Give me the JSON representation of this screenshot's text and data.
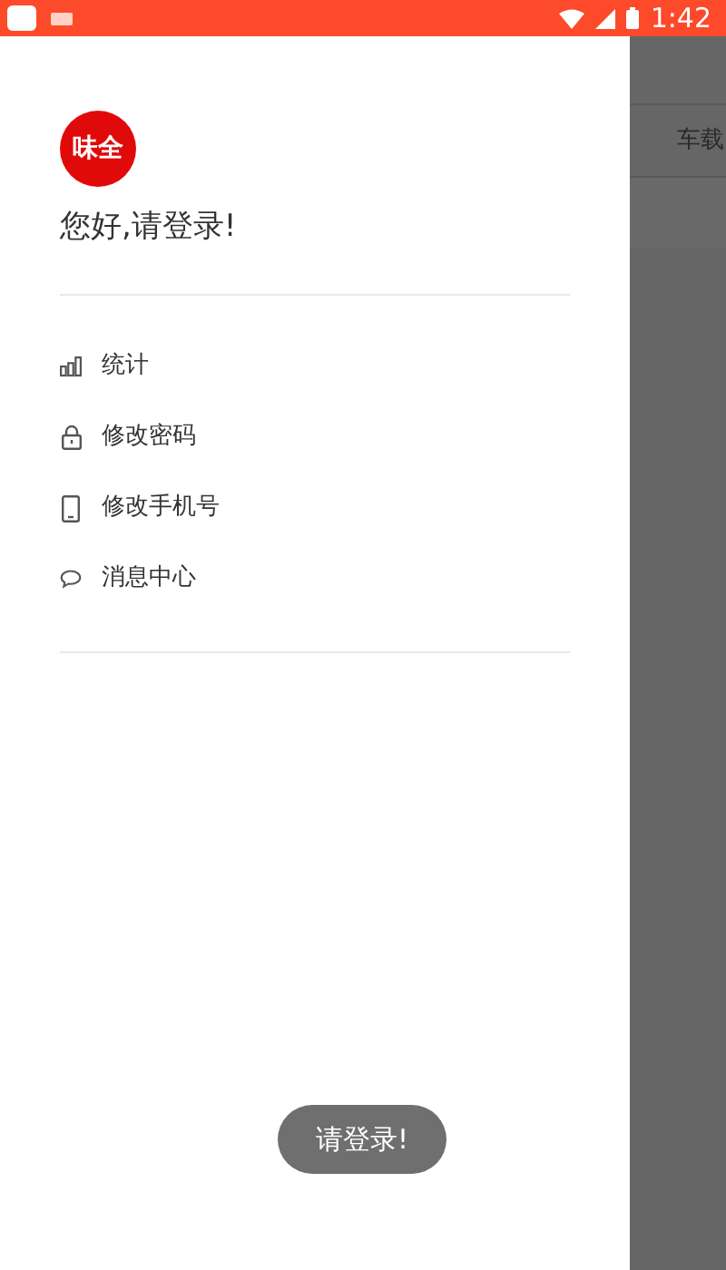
{
  "status_bar": {
    "time": "1:42"
  },
  "drawer": {
    "logo": "味全",
    "greeting": "您好,请登录!",
    "items": [
      {
        "kind": "stats",
        "label": "统计"
      },
      {
        "kind": "lock",
        "label": "修改密码"
      },
      {
        "kind": "phone",
        "label": "修改手机号"
      },
      {
        "kind": "message",
        "label": "消息中心"
      }
    ]
  },
  "background": {
    "tab_label": "车载"
  },
  "toast": "请登录!"
}
